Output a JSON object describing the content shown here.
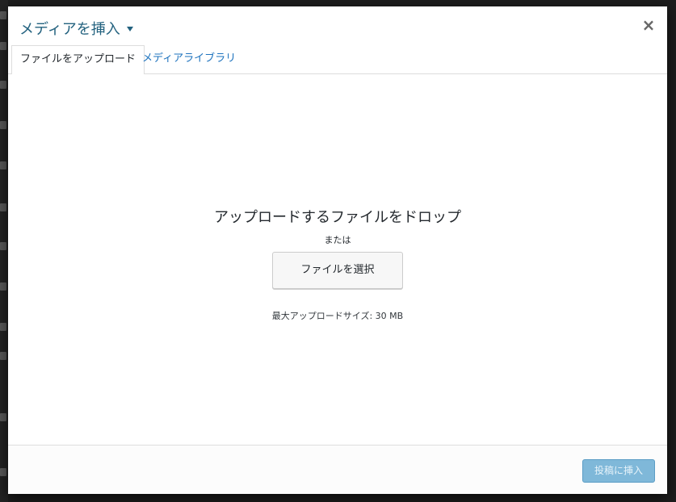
{
  "modal": {
    "title": "メディアを挿入",
    "close_icon": "close-icon"
  },
  "tabs": [
    {
      "label": "ファイルをアップロード",
      "active": true
    },
    {
      "label": "メディアライブラリ",
      "active": false
    }
  ],
  "uploader": {
    "drop_instructions": "アップロードするファイルをドロップ",
    "or": "または",
    "select_button": "ファイルを選択",
    "max_size": "最大アップロードサイズ: 30 MB"
  },
  "toolbar": {
    "insert_button": "投稿に挿入",
    "insert_disabled": true
  },
  "colors": {
    "title": "#23627f",
    "link": "#1e73be",
    "insert_disabled_bg": "#7fb8d9"
  }
}
